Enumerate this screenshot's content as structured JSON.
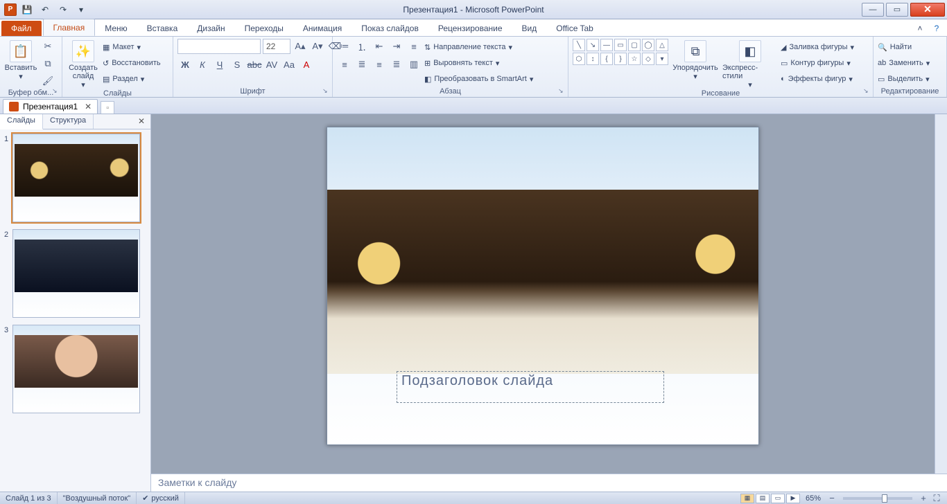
{
  "title": "Презентация1 - Microsoft PowerPoint",
  "qat": {
    "save": "💾",
    "undo": "↶",
    "redo": "↷"
  },
  "tabs": {
    "file": "Файл",
    "items": [
      "Главная",
      "Меню",
      "Вставка",
      "Дизайн",
      "Переходы",
      "Анимация",
      "Показ слайдов",
      "Рецензирование",
      "Вид",
      "Office Tab"
    ],
    "active": 0
  },
  "ribbon": {
    "clipboard": {
      "paste": "Вставить",
      "label": "Буфер обм..."
    },
    "slides": {
      "new": "Создать слайд",
      "layout": "Макет",
      "reset": "Восстановить",
      "section": "Раздел",
      "label": "Слайды"
    },
    "font": {
      "size": "22",
      "label": "Шрифт"
    },
    "para": {
      "dir": "Направление текста",
      "align": "Выровнять текст",
      "smart": "Преобразовать в SmartArt",
      "label": "Абзац"
    },
    "draw": {
      "arrange": "Упорядочить",
      "quick": "Экспресс-стили",
      "fill": "Заливка фигуры",
      "outline": "Контур фигуры",
      "effects": "Эффекты фигур",
      "label": "Рисование"
    },
    "edit": {
      "find": "Найти",
      "replace": "Заменить",
      "select": "Выделить",
      "label": "Редактирование"
    }
  },
  "docTab": {
    "name": "Презентация1"
  },
  "leftPane": {
    "tab1": "Слайды",
    "tab2": "Структура"
  },
  "slide": {
    "subtitle": "Подзаголовок слайда"
  },
  "notes": {
    "placeholder": "Заметки к слайду"
  },
  "status": {
    "slide": "Слайд 1 из 3",
    "theme": "\"Воздушный поток\"",
    "lang": "русский",
    "zoom": "65%"
  }
}
